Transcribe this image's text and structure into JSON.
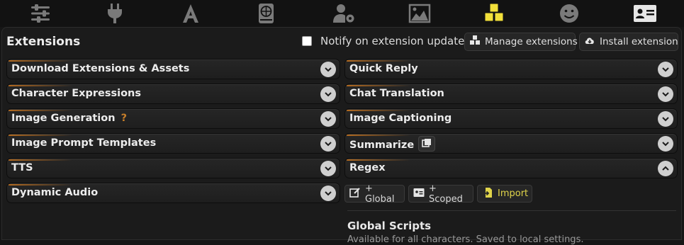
{
  "top_nav": {
    "icons": [
      "sliders-icon",
      "plug-icon",
      "font-icon",
      "globe-book-icon",
      "user-gear-icon",
      "image-icon",
      "cubes-icon",
      "smile-icon",
      "id-card-icon"
    ],
    "active_color": "#f2e03a",
    "default_color": "#7a7a7a"
  },
  "header": {
    "title": "Extensions",
    "notify_label": "Notify on extension updates",
    "notify_checked": false,
    "manage_label": "Manage extensions",
    "install_label": "Install extension"
  },
  "left_drawers": [
    {
      "label": "Download Extensions & Assets"
    },
    {
      "label": "Character Expressions"
    },
    {
      "label": "Image Generation",
      "help": "?"
    },
    {
      "label": "Image Prompt Templates"
    },
    {
      "label": "TTS"
    },
    {
      "label": "Dynamic Audio"
    }
  ],
  "right_drawers": [
    {
      "label": "Quick Reply"
    },
    {
      "label": "Chat Translation"
    },
    {
      "label": "Image Captioning"
    },
    {
      "label": "Summarize"
    },
    {
      "label": "Regex",
      "expanded": true
    }
  ],
  "regex": {
    "global_btn": "+ Global",
    "scoped_btn": "+ Scoped",
    "import_btn": "Import",
    "global_title": "Global Scripts",
    "global_sub": "Available for all characters. Saved to local settings."
  },
  "colors": {
    "accent_orange": "#b36a1f",
    "import_yellow": "#e0d44a"
  }
}
